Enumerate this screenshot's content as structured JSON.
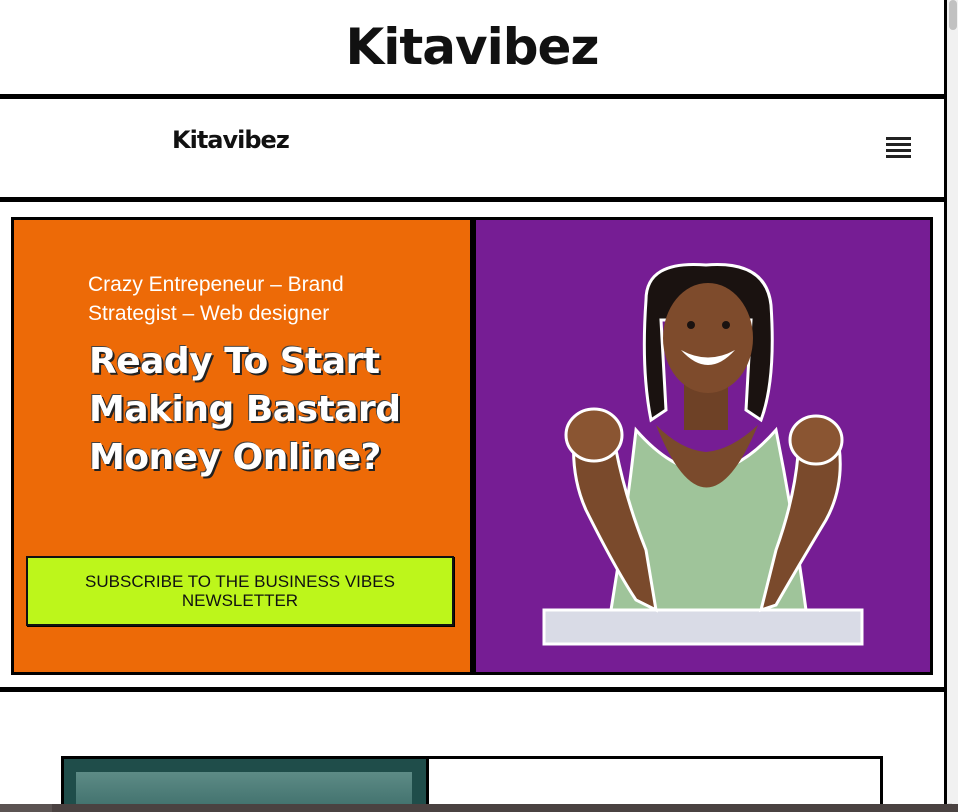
{
  "brand": {
    "logo_text": "Kitavibez"
  },
  "nav": {
    "logo_text": "Kitavibez",
    "menu_icon": "hamburger-menu-icon"
  },
  "hero": {
    "subtitle": "Crazy Entrepeneur – Brand Strategist – Web designer",
    "headline": "Ready To Start Making Bastard Money Online?",
    "cta_label": "SUBSCRIBE TO THE BUSINESS VIBES NEWSLETTER",
    "colors": {
      "left_bg": "#ed6a07",
      "right_bg": "#761d94",
      "cta_bg": "#bdf61b"
    }
  }
}
